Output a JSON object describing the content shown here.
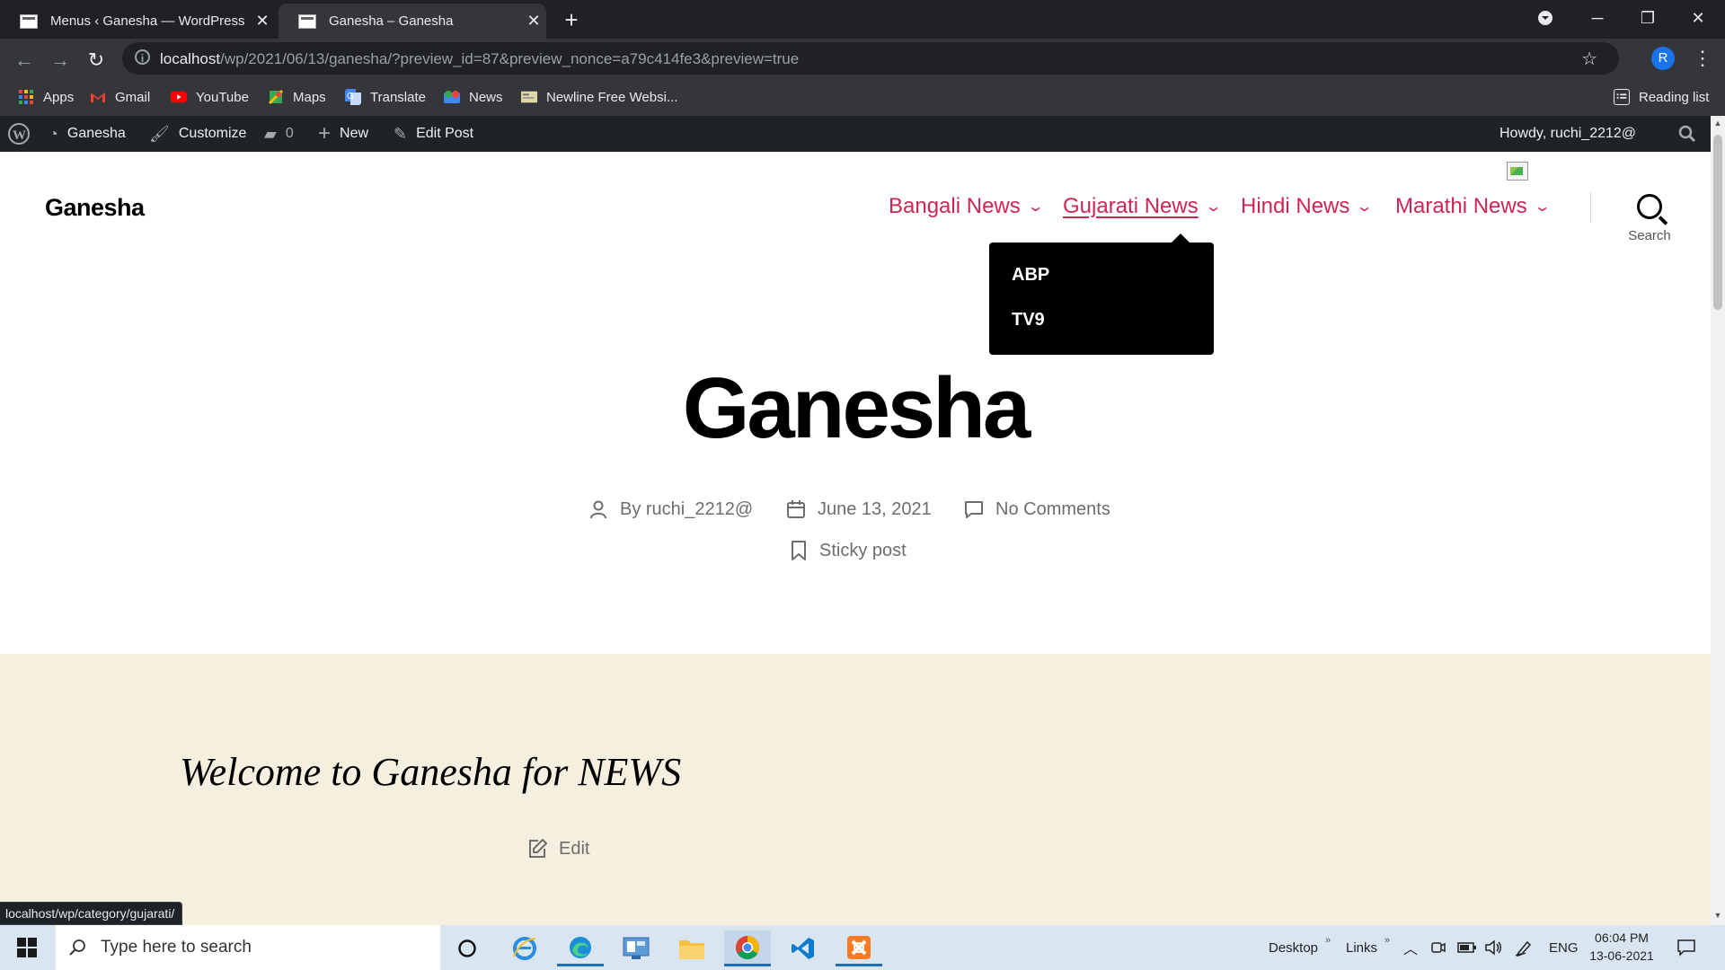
{
  "browser": {
    "tabs": [
      {
        "title": "Menus ‹ Ganesha — WordPress",
        "active": false
      },
      {
        "title": "Ganesha – Ganesha",
        "active": true
      }
    ],
    "url_host": "localhost",
    "url_path": "/wp/2021/06/13/ganesha/?preview_id=87&preview_nonce=a79c414fe3&preview=true",
    "profile_initial": "R",
    "bookmarks": [
      {
        "label": "Apps",
        "icon": "apps-grid-icon"
      },
      {
        "label": "Gmail",
        "icon": "gmail-icon"
      },
      {
        "label": "YouTube",
        "icon": "youtube-icon"
      },
      {
        "label": "Maps",
        "icon": "maps-icon"
      },
      {
        "label": "Translate",
        "icon": "translate-icon"
      },
      {
        "label": "News",
        "icon": "news-icon"
      },
      {
        "label": "Newline Free Websi...",
        "icon": "bookmark-folder-icon"
      }
    ],
    "reading_list": "Reading list",
    "status_url": "localhost/wp/category/gujarati/"
  },
  "adminbar": {
    "site": "Ganesha",
    "customize": "Customize",
    "comments_count": "0",
    "new": "New",
    "edit_post": "Edit Post",
    "howdy": "Howdy, ruchi_2212@"
  },
  "site": {
    "title": "Ganesha",
    "menu": [
      {
        "label": "Bangali News"
      },
      {
        "label": "Gujarati News"
      },
      {
        "label": "Hindi News"
      },
      {
        "label": "Marathi News"
      }
    ],
    "submenu": [
      "ABP",
      "TV9"
    ],
    "search_label": "Search"
  },
  "post": {
    "title": "Ganesha",
    "author": "By ruchi_2212@",
    "date": "June 13, 2021",
    "comments": "No Comments",
    "sticky": "Sticky post",
    "content": "Welcome to Ganesha for NEWS",
    "edit": "Edit"
  },
  "taskbar": {
    "search_placeholder": "Type here to search",
    "desktop": "Desktop",
    "links": "Links",
    "lang": "ENG",
    "time": "06:04 PM",
    "date": "13-06-2021"
  },
  "colors": {
    "accent": "#cd2653",
    "content_bg": "#f5efe0",
    "adminbar": "#1d2327"
  }
}
